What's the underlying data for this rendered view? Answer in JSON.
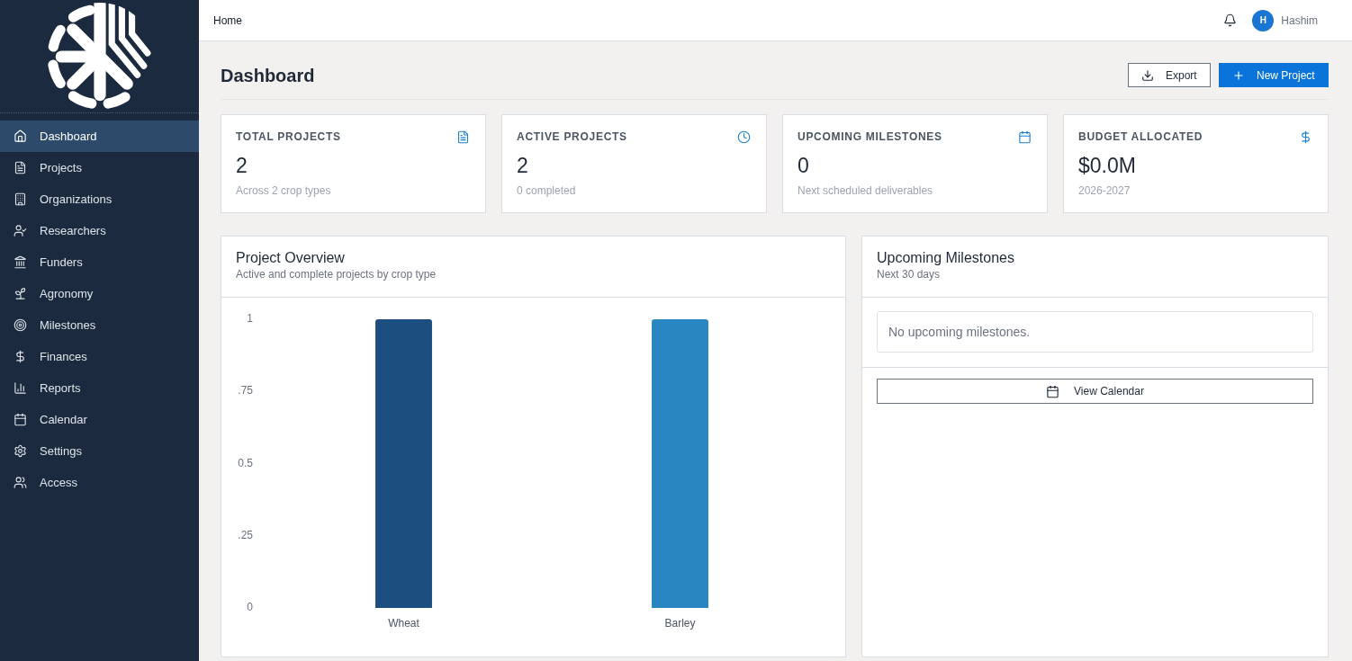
{
  "sidebar": {
    "items": [
      {
        "label": "Dashboard",
        "selected": true
      },
      {
        "label": "Projects",
        "selected": false
      },
      {
        "label": "Organizations",
        "selected": false
      },
      {
        "label": "Researchers",
        "selected": false
      },
      {
        "label": "Funders",
        "selected": false
      },
      {
        "label": "Agronomy",
        "selected": false
      },
      {
        "label": "Milestones",
        "selected": false
      },
      {
        "label": "Finances",
        "selected": false
      },
      {
        "label": "Reports",
        "selected": false
      },
      {
        "label": "Calendar",
        "selected": false
      },
      {
        "label": "Settings",
        "selected": false
      },
      {
        "label": "Access",
        "selected": false
      }
    ]
  },
  "header": {
    "breadcrumb": "Home",
    "user": {
      "initial": "H",
      "name": "Hashim"
    }
  },
  "page": {
    "title": "Dashboard",
    "actions": [
      {
        "label": "Export",
        "kind": "secondary"
      },
      {
        "label": "New Project",
        "kind": "primary"
      }
    ]
  },
  "stats": [
    {
      "label": "TOTAL PROJECTS",
      "value": "2",
      "note": "Across 2 crop types"
    },
    {
      "label": "ACTIVE PROJECTS",
      "value": "2",
      "note": "0 completed"
    },
    {
      "label": "UPCOMING MILESTONES",
      "value": "0",
      "note": "Next scheduled deliverables"
    },
    {
      "label": "BUDGET ALLOCATED",
      "value": "$0.0M",
      "note": "2026-2027"
    }
  ],
  "overview": {
    "title": "Project Overview",
    "subtitle": "Active and complete projects by crop type",
    "chart_data": {
      "type": "bar",
      "categories": [
        "Wheat",
        "Barley"
      ],
      "values": [
        1,
        1
      ],
      "colors": [
        "#1c4f7f",
        "#2a86c1"
      ],
      "ylim": [
        0,
        1
      ],
      "yticks": [
        0,
        {
          "value": 0.25,
          "label": ".25"
        },
        {
          "value": 0.5,
          "label": "0.5"
        },
        {
          "value": 0.75,
          "label": ".75"
        },
        1
      ]
    }
  },
  "milestones": {
    "title": "Upcoming Milestones",
    "subtitle": "Next 30 days",
    "empty_text": "No upcoming milestones.",
    "button": "View Calendar"
  }
}
